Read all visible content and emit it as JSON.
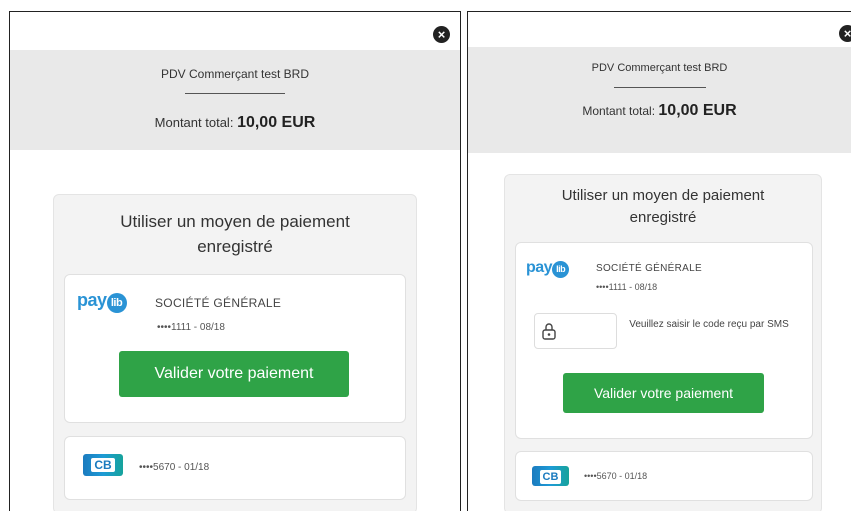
{
  "merchant": "PDV Commerçant test BRD",
  "amount_label": "Montant total:",
  "amount_value": "10,00 EUR",
  "saved_methods_title_1": "Utiliser un moyen de paiement",
  "saved_methods_title_2": "enregistré",
  "paylib": {
    "logo_pay": "pay",
    "logo_lib": "lib",
    "bank": "SOCIÉTÉ GÉNÉRALE",
    "card_number": "••••1111 - 08/18"
  },
  "validate_label": "Valider votre paiement",
  "sms_hint": "Veuillez saisir le code reçu par SMS",
  "cb_card": {
    "logo": "CB",
    "card_number": "••••5670 - 01/18"
  },
  "close_icon": "×",
  "icons": [
    "close-icon",
    "lock-icon"
  ],
  "colors": {
    "accent": "#2fa347",
    "paylib": "#2a93d5",
    "band": "#e9e9e9"
  }
}
